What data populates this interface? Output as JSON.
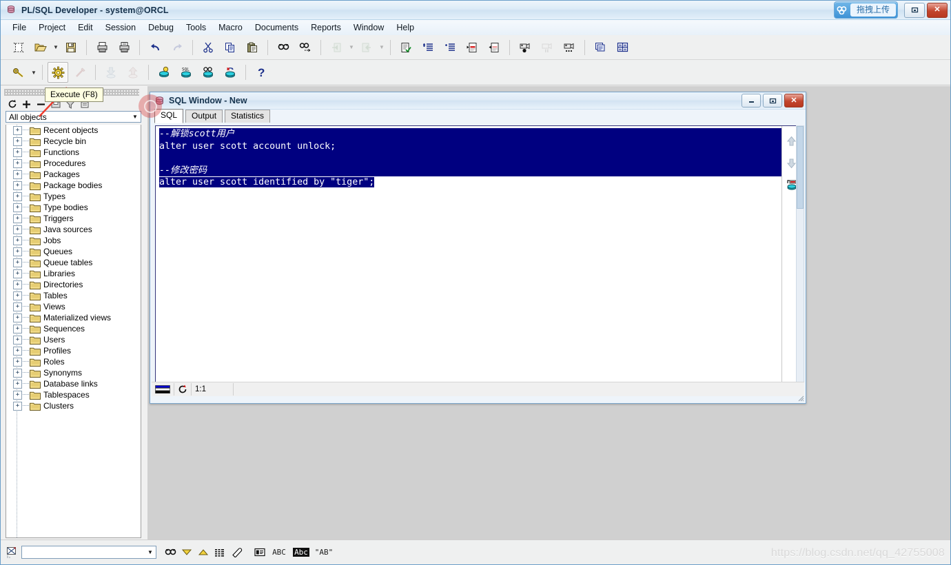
{
  "window": {
    "title": "PL/SQL Developer - system@ORCL",
    "app_icon": "database-icon",
    "upload_button_label": "拖拽上传",
    "upload_icon": "cloud-upload-icon",
    "minimize_label": "–",
    "restore_label": "▭",
    "close_label": "✕"
  },
  "menubar": {
    "items": [
      {
        "label": "File",
        "name": "menu-file"
      },
      {
        "label": "Project",
        "name": "menu-project"
      },
      {
        "label": "Edit",
        "name": "menu-edit"
      },
      {
        "label": "Session",
        "name": "menu-session"
      },
      {
        "label": "Debug",
        "name": "menu-debug"
      },
      {
        "label": "Tools",
        "name": "menu-tools"
      },
      {
        "label": "Macro",
        "name": "menu-macro"
      },
      {
        "label": "Documents",
        "name": "menu-documents"
      },
      {
        "label": "Reports",
        "name": "menu-reports"
      },
      {
        "label": "Window",
        "name": "menu-window"
      },
      {
        "label": "Help",
        "name": "menu-help"
      }
    ]
  },
  "toolbar1": {
    "icons": [
      "new-document-icon",
      "open-folder-icon",
      "open-dropdown-icon",
      "save-icon",
      "print-icon",
      "print-preview-icon",
      "undo-icon",
      "redo-icon",
      "cut-icon",
      "copy-icon",
      "paste-icon",
      "find-icon",
      "find-next-icon",
      "previous-icon",
      "previous-dropdown-icon",
      "next-icon",
      "next-dropdown-icon",
      "check-syntax-icon",
      "indent-icon",
      "unindent-icon",
      "comment-icon",
      "uncomment-icon",
      "record-macro-icon",
      "pause-macro-icon",
      "play-macro-icon",
      "window-list-icon",
      "tile-windows-icon"
    ]
  },
  "toolbar2": {
    "icons": [
      "key-icon",
      "key-dropdown-icon",
      "execute-icon",
      "break-icon",
      "commit-icon",
      "rollback-icon",
      "sql-window-icon",
      "test-window-icon",
      "explain-plan-icon",
      "session-kill-icon",
      "help-icon"
    ]
  },
  "tooltip": {
    "text": "Execute (F8)"
  },
  "browser": {
    "close_icon": "panel-close-icon",
    "tool_icons": [
      "refresh-icon",
      "add-icon",
      "remove-icon",
      "save-layout-icon",
      "filter-icon",
      "properties-icon"
    ],
    "filter": {
      "value": "All objects",
      "dropdown_icon": "chevron-down-icon"
    },
    "tree": [
      {
        "label": "Recent objects",
        "expander": "+"
      },
      {
        "label": "Recycle bin",
        "expander": "+"
      },
      {
        "label": "Functions",
        "expander": "+"
      },
      {
        "label": "Procedures",
        "expander": "+"
      },
      {
        "label": "Packages",
        "expander": "+"
      },
      {
        "label": "Package bodies",
        "expander": "+"
      },
      {
        "label": "Types",
        "expander": "+"
      },
      {
        "label": "Type bodies",
        "expander": "+"
      },
      {
        "label": "Triggers",
        "expander": "+"
      },
      {
        "label": "Java sources",
        "expander": "+"
      },
      {
        "label": "Jobs",
        "expander": "+"
      },
      {
        "label": "Queues",
        "expander": "+"
      },
      {
        "label": "Queue tables",
        "expander": "+"
      },
      {
        "label": "Libraries",
        "expander": "+"
      },
      {
        "label": "Directories",
        "expander": "+"
      },
      {
        "label": "Tables",
        "expander": "+"
      },
      {
        "label": "Views",
        "expander": "+"
      },
      {
        "label": "Materialized views",
        "expander": "+"
      },
      {
        "label": "Sequences",
        "expander": "+"
      },
      {
        "label": "Users",
        "expander": "+"
      },
      {
        "label": "Profiles",
        "expander": "+"
      },
      {
        "label": "Roles",
        "expander": "+"
      },
      {
        "label": "Synonyms",
        "expander": "+"
      },
      {
        "label": "Database links",
        "expander": "+"
      },
      {
        "label": "Tablespaces",
        "expander": "+"
      },
      {
        "label": "Clusters",
        "expander": "+"
      }
    ]
  },
  "sql_window": {
    "title": "SQL Window - New",
    "icon": "database-icon",
    "minimize_label": "–",
    "restore_label": "▭",
    "close_label": "✕",
    "tabs": [
      {
        "label": "SQL",
        "selected": true
      },
      {
        "label": "Output",
        "selected": false
      },
      {
        "label": "Statistics",
        "selected": false
      }
    ],
    "editor": {
      "lines": [
        {
          "text": "--解锁scott用户",
          "comment": true,
          "selected": "full"
        },
        {
          "text": "alter user scott account unlock;",
          "comment": false,
          "selected": "full"
        },
        {
          "text": "",
          "comment": false,
          "selected": "full"
        },
        {
          "text": "--修改密码",
          "comment": true,
          "selected": "full"
        },
        {
          "text": "alter user scott identified by \"tiger\";",
          "comment": false,
          "selected": "partial"
        }
      ],
      "selection_color": "#000080",
      "selection_text_color": "#ffffff"
    },
    "side_icons": [
      "scroll-up-icon",
      "scroll-down-icon",
      "export-data-icon"
    ],
    "statusbar": {
      "connection_icon": "connection-indicator-icon",
      "refresh_icon": "refresh-red-icon",
      "cursor_position": "1:1",
      "message": ""
    }
  },
  "statusbar": {
    "icon": "no-connection-icon",
    "combo_value": "",
    "combo_dropdown_icon": "chevron-down-icon",
    "buttons": [
      "find-icon",
      "filter-down-icon",
      "filter-up-icon",
      "grid-icon",
      "eraser-icon",
      "record-view-icon",
      "abc-icon",
      "highlight-abc-icon",
      "quoted-ab-icon"
    ],
    "button_labels": [
      "",
      "",
      "",
      "",
      "",
      "",
      "ABC",
      "Abc",
      "\"AB\""
    ]
  },
  "watermark": {
    "text": "https://blog.csdn.net/qq_42755008"
  },
  "colors": {
    "title_blue": "#cfe2f2",
    "selection": "#000080",
    "editor_border": "#34347a",
    "mdi_background": "#d0d0d0",
    "accent_red": "#d63c3c"
  }
}
